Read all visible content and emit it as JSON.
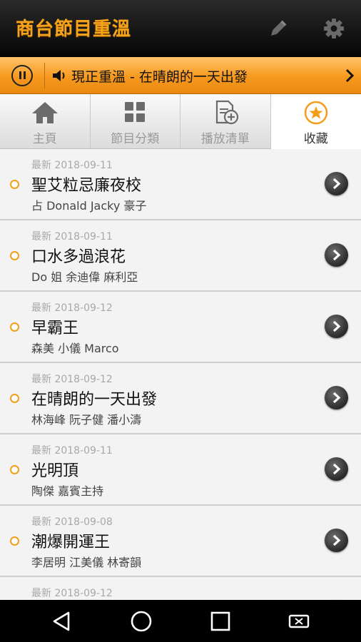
{
  "app": {
    "title": "商台節目重溫"
  },
  "toolbar": {
    "edit_icon": "pencil-icon",
    "settings_icon": "gear-icon"
  },
  "now_playing": {
    "text": "現正重溫 - 在晴朗的一天出發",
    "accent": "#f7991e"
  },
  "tabs": [
    {
      "label": "主頁",
      "icon": "home-icon",
      "active": false
    },
    {
      "label": "節目分類",
      "icon": "grid-icon",
      "active": false
    },
    {
      "label": "播放清單",
      "icon": "playlist-add-icon",
      "active": false
    },
    {
      "label": "收藏",
      "icon": "star-icon",
      "active": true
    }
  ],
  "items": [
    {
      "date": "最新  2018-09-11",
      "title": "聖艾粒忌廉夜校",
      "hosts": "占 Donald Jacky 豪子"
    },
    {
      "date": "最新  2018-09-11",
      "title": "口水多過浪花",
      "hosts": "Do 姐 余迪偉 麻利亞"
    },
    {
      "date": "最新  2018-09-12",
      "title": "早霸王",
      "hosts": "森美 小儀 Marco"
    },
    {
      "date": "最新  2018-09-12",
      "title": "在晴朗的一天出發",
      "hosts": "林海峰 阮子健 潘小濤"
    },
    {
      "date": "最新  2018-09-11",
      "title": "光明頂",
      "hosts": "陶傑 嘉賓主持"
    },
    {
      "date": "最新  2018-09-08",
      "title": "潮爆開運王",
      "hosts": "李居明 江美儀 林寄韻"
    },
    {
      "date": "最新  2018-09-12",
      "title": "",
      "hosts": ""
    }
  ]
}
